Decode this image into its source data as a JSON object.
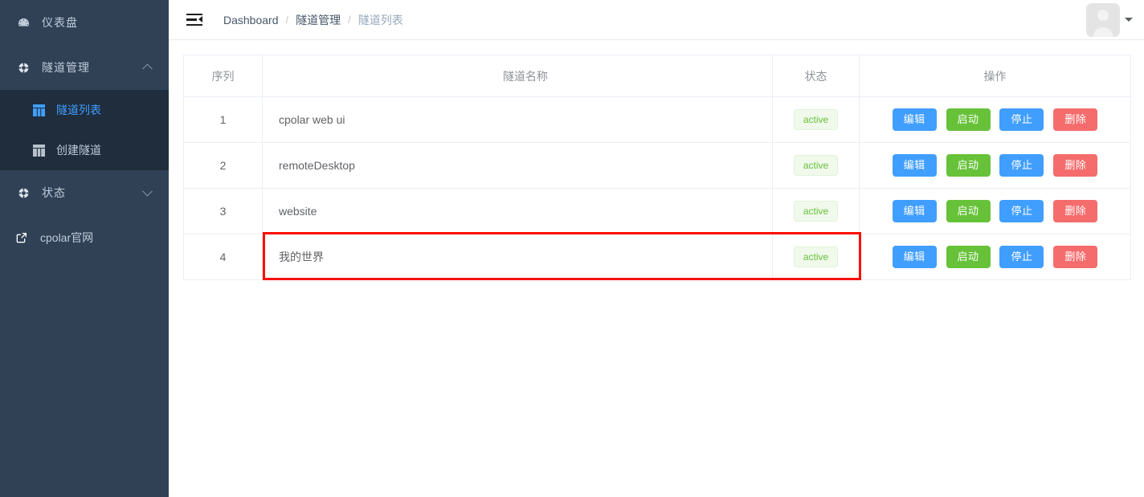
{
  "sidebar": {
    "items": [
      {
        "label": "仪表盘",
        "icon": "dashboard-icon",
        "type": "link",
        "active": false
      },
      {
        "label": "隧道管理",
        "icon": "tunnel-icon",
        "type": "group",
        "expanded": true,
        "arrow": "chevron-up-icon"
      },
      {
        "label": "状态",
        "icon": "status-icon",
        "type": "group",
        "expanded": false,
        "arrow": "chevron-down-icon"
      },
      {
        "label": "cpolar官网",
        "icon": "external-link-icon",
        "type": "external"
      }
    ],
    "submenu": [
      {
        "label": "隧道列表",
        "icon": "grid-icon",
        "active": true
      },
      {
        "label": "创建隧道",
        "icon": "grid-icon",
        "active": false
      }
    ],
    "colors": {
      "bg": "#304156",
      "submenu_bg": "#1f2d3d",
      "text": "#bfcbd9",
      "active": "#409eff"
    }
  },
  "topbar": {
    "menu_toggle_icon": "menu-fold-icon",
    "breadcrumb": [
      {
        "label": "Dashboard",
        "current": false
      },
      {
        "label": "隧道管理",
        "current": false
      },
      {
        "label": "隧道列表",
        "current": true
      }
    ],
    "separator": "/",
    "avatar_icon": "user-avatar-icon",
    "caret_icon": "caret-down-icon"
  },
  "table": {
    "headers": [
      "序列",
      "隧道名称",
      "状态",
      "操作"
    ],
    "rows": [
      {
        "seq": "1",
        "name": "cpolar web ui",
        "status": "active",
        "highlighted": false
      },
      {
        "seq": "2",
        "name": "remoteDesktop",
        "status": "active",
        "highlighted": false
      },
      {
        "seq": "3",
        "name": "website",
        "status": "active",
        "highlighted": false
      },
      {
        "seq": "4",
        "name": "我的世界",
        "status": "active",
        "highlighted": true
      }
    ],
    "actions": [
      {
        "label": "编辑",
        "style": "edit",
        "color": "#409eff"
      },
      {
        "label": "启动",
        "style": "start",
        "color": "#67c23a"
      },
      {
        "label": "停止",
        "style": "stop",
        "color": "#409eff"
      },
      {
        "label": "删除",
        "style": "delete",
        "color": "#f56c6c"
      }
    ],
    "status_badge": {
      "text_color": "#67c23a",
      "bg_color": "#f0f9eb"
    }
  },
  "annotation": {
    "highlight_color": "#fb0f00",
    "target_row": "4"
  }
}
